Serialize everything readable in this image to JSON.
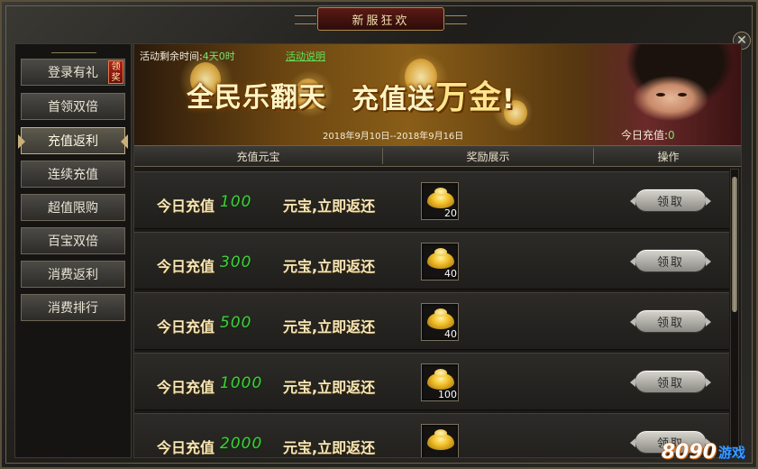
{
  "window": {
    "title": "新服狂欢",
    "close_glyph": "✕"
  },
  "sidebar": {
    "items": [
      {
        "label": "登录有礼",
        "badge": "领奖",
        "active": false
      },
      {
        "label": "首领双倍",
        "active": false
      },
      {
        "label": "充值返利",
        "active": true
      },
      {
        "label": "连续充值",
        "active": false
      },
      {
        "label": "超值限购",
        "active": false
      },
      {
        "label": "百宝双倍",
        "active": false
      },
      {
        "label": "消费返利",
        "active": false
      },
      {
        "label": "消费排行",
        "active": false
      }
    ]
  },
  "banner": {
    "countdown_label": "活动剩余时间:",
    "countdown_value": "4天0时",
    "rules_link": "活动说明",
    "slogan_a": "全民乐翻天",
    "slogan_b_prefix": "充值送",
    "slogan_b_big": "万金",
    "slogan_b_suffix": "!",
    "date_range": "2018年9月10日--2018年9月16日",
    "today_recharge_label": "今日充值:",
    "today_recharge_value": "0"
  },
  "table": {
    "headers": [
      "充值元宝",
      "奖励展示",
      "操作"
    ],
    "rows": [
      {
        "label": "今日充值",
        "amount": "100",
        "desc": "元宝,立即返还",
        "reward_icon": "gold-ingot-icon",
        "reward_qty": "20",
        "button": "领取"
      },
      {
        "label": "今日充值",
        "amount": "300",
        "desc": "元宝,立即返还",
        "reward_icon": "gold-ingot-icon",
        "reward_qty": "40",
        "button": "领取"
      },
      {
        "label": "今日充值",
        "amount": "500",
        "desc": "元宝,立即返还",
        "reward_icon": "gold-ingot-icon",
        "reward_qty": "40",
        "button": "领取"
      },
      {
        "label": "今日充值",
        "amount": "1000",
        "desc": "元宝,立即返还",
        "reward_icon": "gold-ingot-icon",
        "reward_qty": "100",
        "button": "领取"
      },
      {
        "label": "今日充值",
        "amount": "2000",
        "desc": "元宝,立即返还",
        "reward_icon": "gold-ingot-icon",
        "reward_qty": "",
        "button": "领取"
      }
    ]
  },
  "watermark": {
    "digits": "8090",
    "text": "游戏"
  },
  "colors": {
    "accent_gold": "#c8b07a",
    "amount_green": "#3fcf3a",
    "badge_red": "#b32018"
  }
}
